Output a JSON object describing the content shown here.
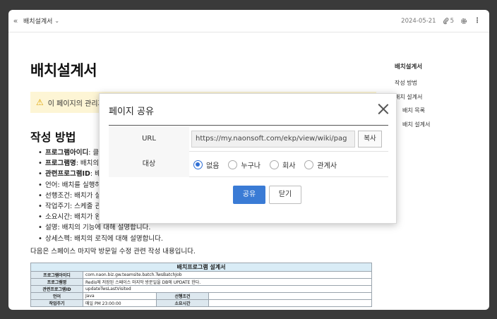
{
  "topbar": {
    "breadcrumb": "배치설계서",
    "date": "2024-05-21",
    "attachments_count": "5"
  },
  "page": {
    "title": "배치설계서",
    "warning": "이 페이지의 관리자",
    "section_title": "작성 방법",
    "bullets": [
      {
        "label": "프로그램아이디",
        "text": ": 클"
      },
      {
        "label": "프로그램명",
        "text": ": 배치의"
      },
      {
        "label": "관련프로그램ID",
        "text": ": 배"
      },
      {
        "label": "",
        "text": "언어: 배치를 실행하"
      },
      {
        "label": "",
        "text": "선행조건: 배치가 실"
      },
      {
        "label": "",
        "text": "작업주기: 스케줄 관"
      },
      {
        "label": "",
        "text": "소요시간: 배치가 완"
      },
      {
        "label": "",
        "text": "설명: 배치의 기능에 대해 설명합니다."
      },
      {
        "label": "",
        "text": "상세스펙: 배치의 로직에 대해 설명합니다."
      }
    ],
    "paragraph": "다음은 스페이스 마지막 방문일 수정 관련 작성 내용입니다."
  },
  "table": {
    "title": "배치프로그램 설계서",
    "rows": [
      {
        "label": "프로그램아이디",
        "value": "com.naon.biz.gw.teamsite.batch.TwsBatchJob"
      },
      {
        "label": "프로그램명",
        "value": "Redis에 저장된 스페이스 마지막 방문일을 DB에 UPDATE 한다."
      },
      {
        "label": "관련프로그램ID",
        "value": "updateTwsLastVisited"
      }
    ],
    "lang_label": "언어",
    "lang_value": "Java",
    "pre_label": "선행조건",
    "cycle_label": "작업주기",
    "cycle_value": "매일 PM 23:00:00",
    "time_label": "소요시간"
  },
  "toc": {
    "title": "배치설계서",
    "items": [
      "작성 방법",
      "배치 설계서",
      "배치 목록",
      "배치 설계서"
    ]
  },
  "dialog": {
    "title": "페이지 공유",
    "url_label": "URL",
    "url_value": "https://my.naonsoft.com/ekp/view/wiki/pag",
    "copy_label": "복사",
    "target_label": "대상",
    "options": [
      "없음",
      "누구나",
      "회사",
      "관계사"
    ],
    "selected": "없음",
    "share_label": "공유",
    "close_label": "닫기"
  },
  "colors": {
    "primary": "#3a7bd5",
    "warning_bg": "#fdf5d5",
    "table_header": "#d9ecf6"
  }
}
